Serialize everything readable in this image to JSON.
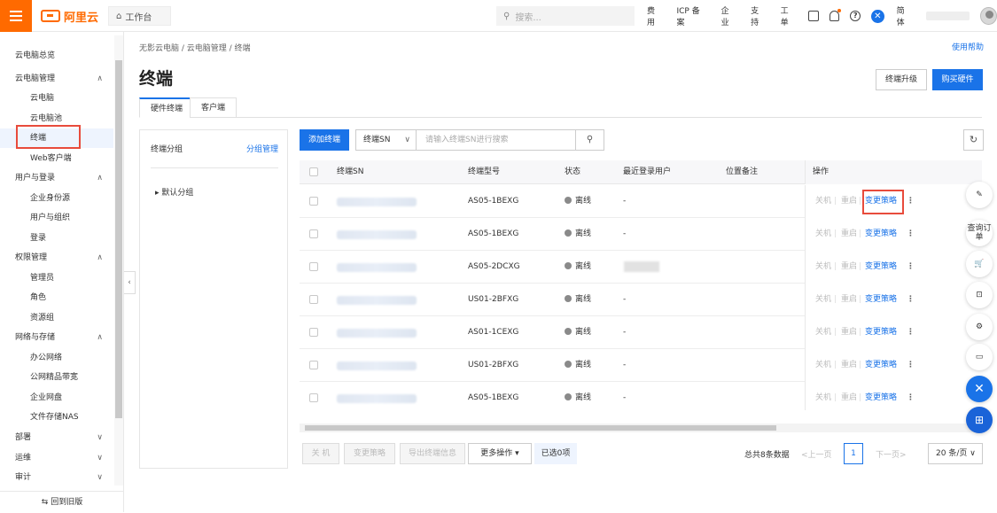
{
  "topbar": {
    "logo": "阿里云",
    "workbench": "工作台",
    "search_placeholder": "搜索...",
    "links": [
      "费用",
      "ICP 备案",
      "企业",
      "支持",
      "工单"
    ],
    "lang": "简体"
  },
  "sidebar": {
    "items": [
      {
        "label": "云电脑总览",
        "level": 1
      },
      {
        "label": "云电脑管理",
        "level": 1,
        "expanded": true
      },
      {
        "label": "云电脑",
        "level": 2
      },
      {
        "label": "云电脑池",
        "level": 2
      },
      {
        "label": "终端",
        "level": 2,
        "active": true
      },
      {
        "label": "Web客户端",
        "level": 2
      },
      {
        "label": "用户与登录",
        "level": 1,
        "expanded": true
      },
      {
        "label": "企业身份源",
        "level": 2
      },
      {
        "label": "用户与组织",
        "level": 2
      },
      {
        "label": "登录",
        "level": 2
      },
      {
        "label": "权限管理",
        "level": 1,
        "expanded": true
      },
      {
        "label": "管理员",
        "level": 2
      },
      {
        "label": "角色",
        "level": 2
      },
      {
        "label": "资源组",
        "level": 2
      },
      {
        "label": "网络与存储",
        "level": 1,
        "expanded": true
      },
      {
        "label": "办公网络",
        "level": 2
      },
      {
        "label": "公网精品带宽",
        "level": 2
      },
      {
        "label": "企业网盘",
        "level": 2
      },
      {
        "label": "文件存储NAS",
        "level": 2
      },
      {
        "label": "部署",
        "level": 1,
        "expanded": false
      },
      {
        "label": "运维",
        "level": 1,
        "expanded": false
      },
      {
        "label": "审计",
        "level": 1,
        "expanded": false
      }
    ],
    "footer": "回到旧版"
  },
  "breadcrumb": "无影云电脑 / 云电脑管理 / 终端",
  "help_link": "使用帮助",
  "page_title": "终端",
  "actions": {
    "upgrade": "终端升级",
    "buy": "购买硬件"
  },
  "tabs": [
    "硬件终端",
    "客户端"
  ],
  "group_panel": {
    "title": "终端分组",
    "manage": "分组管理",
    "node": "默认分组"
  },
  "toolbar": {
    "add": "添加终端",
    "filter_field": "终端SN",
    "search_placeholder": "请输入终端SN进行搜索"
  },
  "table": {
    "headers": [
      "终端SN",
      "终端型号",
      "状态",
      "最近登录用户",
      "位置备注",
      "操作"
    ],
    "rows": [
      {
        "model": "AS05-1BEXG",
        "status": "离线",
        "user": "-"
      },
      {
        "model": "AS05-1BEXG",
        "status": "离线",
        "user": "-"
      },
      {
        "model": "AS05-2DCXG",
        "status": "离线",
        "user": ""
      },
      {
        "model": "US01-2BFXG",
        "status": "离线",
        "user": "-"
      },
      {
        "model": "AS01-1CEXG",
        "status": "离线",
        "user": "-"
      },
      {
        "model": "US01-2BFXG",
        "status": "离线",
        "user": "-"
      },
      {
        "model": "AS05-1BEXG",
        "status": "离线",
        "user": "-"
      }
    ],
    "ops": {
      "shutdown": "关机",
      "restart": "重启",
      "change": "变更策略",
      "more": "⋮"
    }
  },
  "bottom": {
    "shutdown": "关 机",
    "change_policy": "变更策略",
    "export": "导出终端信息",
    "more_ops": "更多操作",
    "selected": "已选0项",
    "total": "总共8条数据",
    "prev": "<上一页",
    "page": "1",
    "next": "下一页>",
    "pagesize": "20 条/页"
  },
  "float_bar": {
    "query_order": "查询订单"
  }
}
